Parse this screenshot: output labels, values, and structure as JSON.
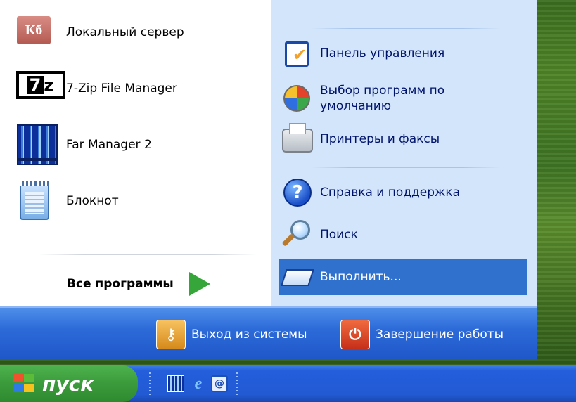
{
  "start_menu": {
    "programs": [
      {
        "label": "Локальный сервер",
        "icon": "server-icon",
        "icon_text": "Кб"
      },
      {
        "label": "7-Zip File Manager",
        "icon": "7zip-icon",
        "icon_text": "7z"
      },
      {
        "label": "Far Manager 2",
        "icon": "far-manager-icon"
      },
      {
        "label": "Блокнот",
        "icon": "notepad-icon"
      }
    ],
    "all_programs": {
      "label": "Все программы",
      "icon": "green-arrow-icon"
    },
    "right_items": [
      {
        "label": "Панель управления",
        "icon": "control-panel-icon"
      },
      {
        "label": "Выбор программ по умолчанию",
        "icon": "default-programs-icon"
      },
      {
        "label": "Принтеры и факсы",
        "icon": "printer-icon"
      },
      {
        "label": "Справка и поддержка",
        "icon": "help-icon"
      },
      {
        "label": "Поиск",
        "icon": "search-icon"
      },
      {
        "label": "Выполнить...",
        "icon": "run-icon",
        "selected": true
      }
    ],
    "logoff_label": "Выход из системы",
    "shutdown_label": "Завершение работы"
  },
  "taskbar": {
    "start_label": "пуск",
    "quick_launch": [
      "far-manager-icon",
      "internet-explorer-icon",
      "email-icon"
    ]
  },
  "colors": {
    "selection": "#2f71cd",
    "bar_blue": "#2d6bd9",
    "start_green": "#3c9c3c"
  }
}
